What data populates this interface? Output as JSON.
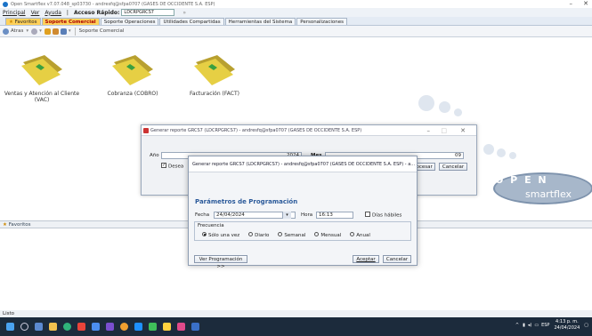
{
  "window": {
    "title": "Open Smartflex v7.07.048_sp03730 - andresfq@sfpa0707 (GASES DE OCCIDENTE S.A. ESP)",
    "min": "–",
    "close": "✕"
  },
  "menu": {
    "items": [
      "Principal",
      "Ver",
      "Ayuda"
    ],
    "separator": "|",
    "quick_access_label": "Acceso Rápido:",
    "quick_access_value": "LDCRPGRCS7"
  },
  "tabs": [
    "Favoritos",
    "Soporte Comercial",
    "Soporte Operaciones",
    "Utilidades Compartidas",
    "Herramientas del Sistema",
    "Personalizaciones"
  ],
  "toolbar": {
    "back_label": "Atras",
    "breadcrumb": "Soporte Comercial"
  },
  "folders": [
    {
      "label": "Ventas y Atención al Cliente (VAC)"
    },
    {
      "label": "Cobranza (COBRO)"
    },
    {
      "label": "Facturación (FACT)"
    }
  ],
  "favorites_header": "Favoritos",
  "statusbar": "Listo",
  "brand": {
    "open": "O P E N",
    "product": "smartflex"
  },
  "outer_dialog": {
    "title": "Generar reporte GRCS7 (LDCRPGRCS7) - andresfq@sfpa0707 (GASES DE OCCIDENTE S.A. ESP)",
    "year_label": "Año",
    "year_value": "2024",
    "month_label": "Mes",
    "month_value": "09",
    "checkbox_label": "Desea",
    "process_button": "Procesar",
    "cancel_button": "Cancelar"
  },
  "inner_dialog": {
    "title": "Generar reporte GRCS7 (LDCRPGRCS7) - andresfq@sfpa0707 (GASES DE OCCIDENTE S.A. ESP) - a...",
    "section_title": "Parámetros de Programación",
    "date_label": "Fecha",
    "date_value": "24/04/2024",
    "time_label": "Hora",
    "time_value": "16:13",
    "business_days_label": "Días hábiles",
    "frequency_label": "Frecuencia",
    "frequency_options": [
      "Sólo una vez",
      "Diario",
      "Semanal",
      "Mensual",
      "Anual"
    ],
    "frequency_selected": "Sólo una vez",
    "view_schedule_button": "Ver Programación >>",
    "accept_button": "Aceptar",
    "cancel_button": "Cancelar"
  },
  "tray": {
    "language": "ESP",
    "time": "4:13 p. m.",
    "date": "24/04/2024"
  },
  "colors": {
    "accent": "#2b5a9a",
    "active_tab": "#ffd15a",
    "taskbar": "#1c2b3c"
  }
}
